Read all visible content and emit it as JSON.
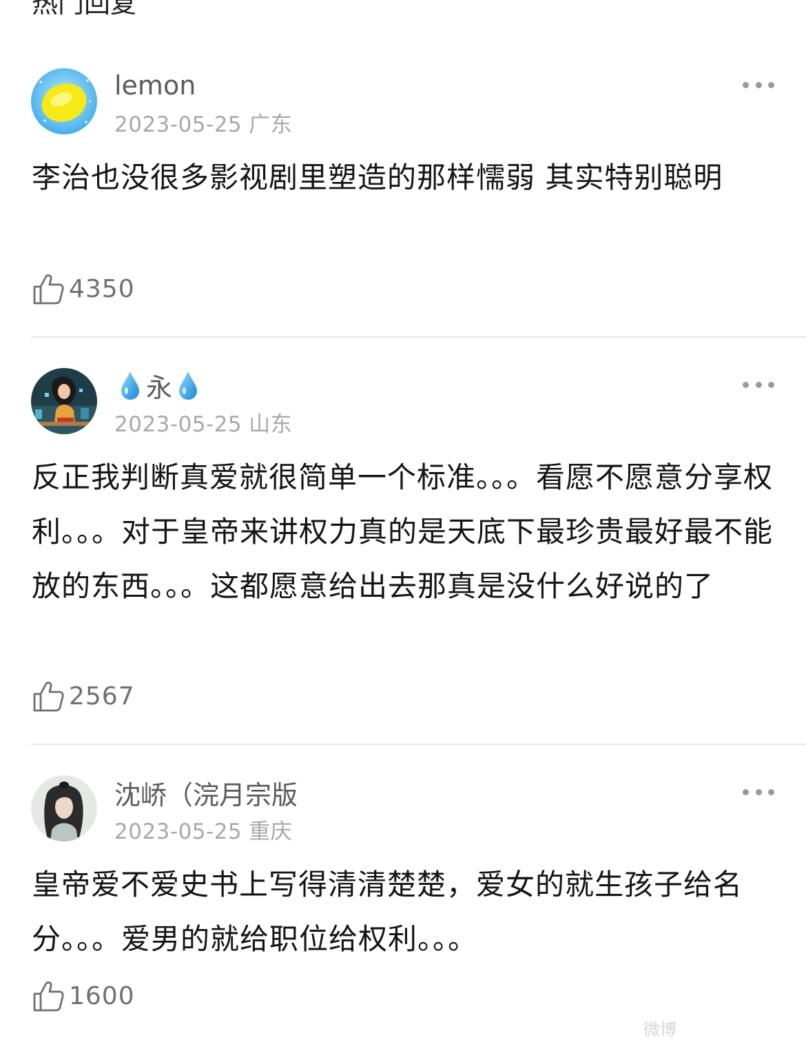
{
  "header_fragment": "热门回复",
  "comments": [
    {
      "username": "lemon",
      "date": "2023-05-25",
      "location": "广东",
      "text": "李治也没很多影视剧里塑造的那样懦弱 其实特别聪明",
      "likes": "4350",
      "avatar_icon": "lemon-avatar"
    },
    {
      "username": "永",
      "username_decoration": "droplet-icon",
      "date": "2023-05-25",
      "location": "山东",
      "text": "反正我判断真爱就很简单一个标准。。。看愿不愿意分享权利。。。对于皇帝来讲权力真的是天底下最珍贵最好最不能放的东西。。。这都愿意给出去那真是没什么好说的了",
      "likes": "2567",
      "avatar_icon": "woman-avatar"
    },
    {
      "username": "沈峤（浣月宗版",
      "date": "2023-05-25",
      "location": "重庆",
      "text": "皇帝爱不爱史书上写得清清楚楚，爱女的就生孩子给名分。。。爱男的就给职位给权利。。。",
      "likes": "1600",
      "avatar_icon": "ancient-man-avatar"
    }
  ],
  "watermark": "微博"
}
